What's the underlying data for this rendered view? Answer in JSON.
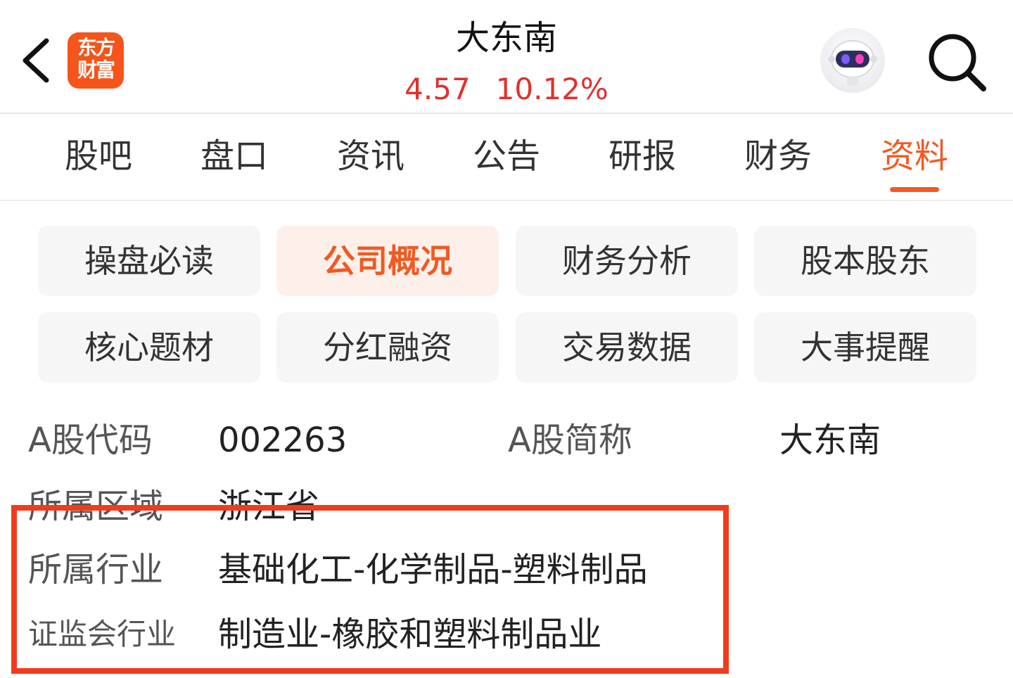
{
  "header": {
    "logo_line1": "东方",
    "logo_line2": "财富",
    "stock_name": "大东南",
    "price": "4.57",
    "change_pct": "10.12%",
    "price_color": "#e0302d"
  },
  "tabs": [
    {
      "label": "股吧"
    },
    {
      "label": "盘口"
    },
    {
      "label": "资讯"
    },
    {
      "label": "公告"
    },
    {
      "label": "研报"
    },
    {
      "label": "财务"
    },
    {
      "label": "资料",
      "active": true
    }
  ],
  "subnav": [
    {
      "label": "操盘必读"
    },
    {
      "label": "公司概况",
      "active": true
    },
    {
      "label": "财务分析"
    },
    {
      "label": "股本股东"
    },
    {
      "label": "核心题材"
    },
    {
      "label": "分红融资"
    },
    {
      "label": "交易数据"
    },
    {
      "label": "大事提醒"
    }
  ],
  "info": {
    "code_label": "A股代码",
    "code_value": "002263",
    "short_name_label": "A股简称",
    "short_name_value": "大东南",
    "region_label": "所属区域",
    "region_value": "浙江省",
    "industry_label": "所属行业",
    "industry_value": "基础化工-化学制品-塑料制品",
    "csrc_industry_label": "证监会行业",
    "csrc_industry_value": "制造业-橡胶和塑料制品业"
  },
  "colors": {
    "accent": "#f05a22",
    "highlight_border": "#f23a1e",
    "logo_bg": "#f5541a"
  }
}
